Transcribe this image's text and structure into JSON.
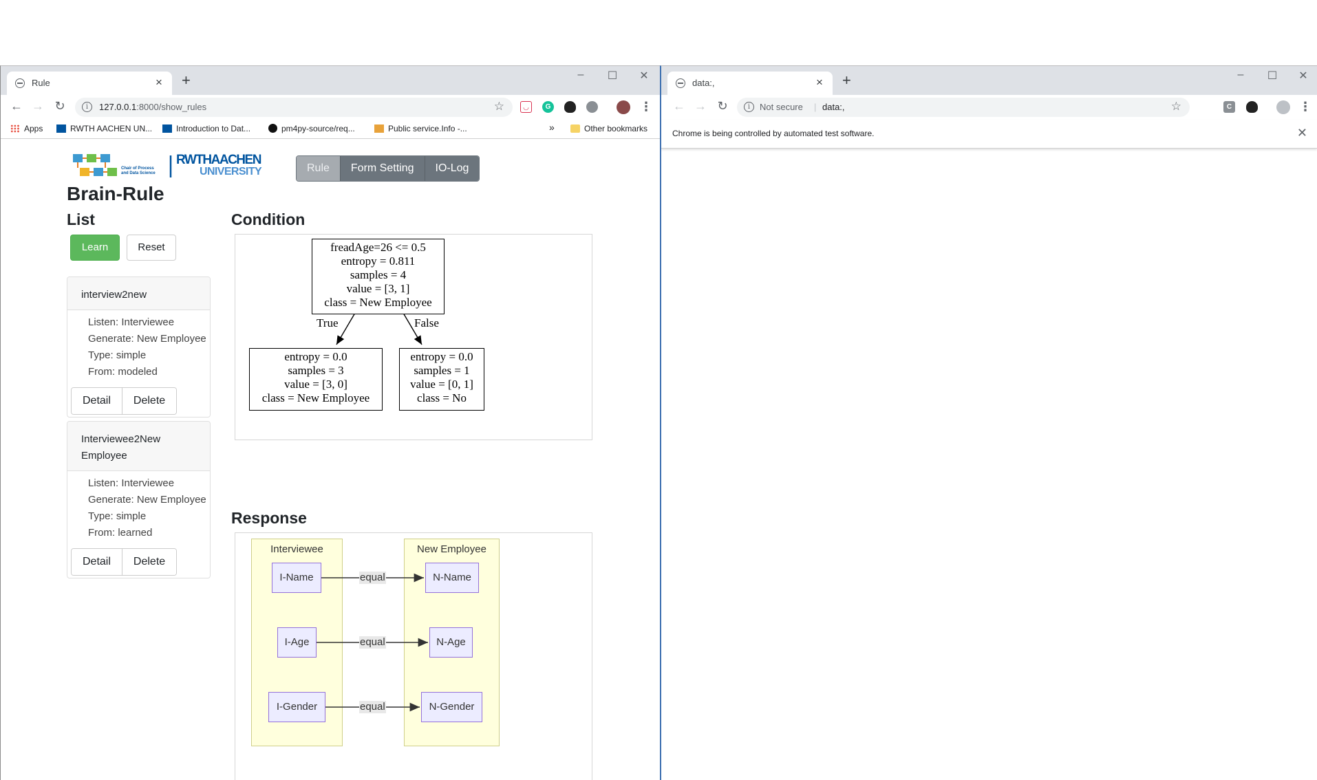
{
  "left_window": {
    "tab_title": "Rule",
    "url_host": "127.0.0.1",
    "url_rest": ":8000/show_rules",
    "bookmarks": [
      {
        "label": "Apps"
      },
      {
        "label": "RWTH AACHEN UN..."
      },
      {
        "label": "Introduction to Dat..."
      },
      {
        "label": "pm4py-source/req..."
      },
      {
        "label": "Public service.Info -..."
      }
    ],
    "bookmarks_overflow": "»",
    "other_bookmarks": "Other bookmarks"
  },
  "page": {
    "brand": "Brain-Rule",
    "logo_text_1": "RWTHAACHEN",
    "logo_text_2": "UNIVERSITY",
    "logo_sub_1": "Chair of Process",
    "logo_sub_2": "and Data Science",
    "nav": [
      {
        "label": "Rule",
        "active": true
      },
      {
        "label": "Form Setting",
        "active": false
      },
      {
        "label": "IO-Log",
        "active": false
      }
    ],
    "list_heading": "List",
    "learn_label": "Learn",
    "reset_label": "Reset",
    "rules": [
      {
        "title": "interview2new",
        "listen": "Listen: Interviewee",
        "generate": "Generate: New Employee",
        "type": "Type: simple",
        "from": "From: modeled",
        "detail_label": "Detail",
        "delete_label": "Delete"
      },
      {
        "title": "Interviewee2New Employee",
        "listen": "Listen: Interviewee",
        "generate": "Generate: New Employee",
        "type": "Type: simple",
        "from": "From: learned",
        "detail_label": "Detail",
        "delete_label": "Delete"
      }
    ],
    "condition_heading": "Condition",
    "response_heading": "Response"
  },
  "decision_tree": {
    "root": [
      "freadAge=26 <= 0.5",
      "entropy = 0.811",
      "samples = 4",
      "value = [3, 1]",
      "class = New Employee"
    ],
    "left": [
      "entropy = 0.0",
      "samples = 3",
      "value = [3, 0]",
      "class = New Employee"
    ],
    "right": [
      "entropy = 0.0",
      "samples = 1",
      "value = [0, 1]",
      "class = No"
    ],
    "true_label": "True",
    "false_label": "False"
  },
  "response_diagram": {
    "source_cluster": "Interviewee",
    "target_cluster": "New Employee",
    "mappings": [
      {
        "source": "I-Name",
        "relation": "equal",
        "target": "N-Name"
      },
      {
        "source": "I-Age",
        "relation": "equal",
        "target": "N-Age"
      },
      {
        "source": "I-Gender",
        "relation": "equal",
        "target": "N-Gender"
      }
    ]
  },
  "right_window": {
    "tab_title": "data:,",
    "security_label": "Not secure",
    "url": "data:,",
    "infobar_message": "Chrome is being controlled by automated test software."
  }
}
